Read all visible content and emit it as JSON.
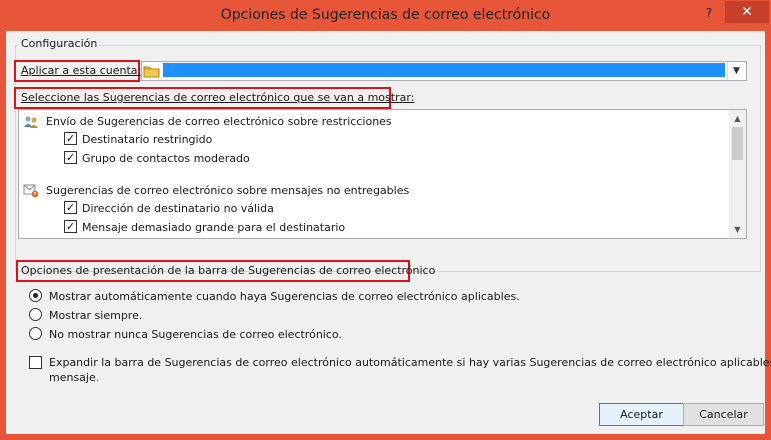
{
  "window": {
    "title": "Opciones de Sugerencias de correo electrónico",
    "help_glyph": "?",
    "close_glyph": "✕"
  },
  "config_group": {
    "label": "Configuración",
    "account_label": "Aplicar a esta cuenta:",
    "account_value": ""
  },
  "tips_list": {
    "label": "Seleccione las Sugerencias de correo electrónico que se van a mostrar:",
    "categories": [
      {
        "icon": "restricted-contacts-icon",
        "label": "Envío de Sugerencias de correo electrónico sobre restricciones",
        "items": [
          {
            "label": "Destinatario restringido",
            "checked": true
          },
          {
            "label": "Grupo de contactos moderado",
            "checked": true
          }
        ]
      },
      {
        "icon": "undeliverable-message-icon",
        "label": "Sugerencias de correo electrónico sobre mensajes no entregables",
        "items": [
          {
            "label": "Dirección de destinatario no válida",
            "checked": true
          },
          {
            "label": "Mensaje demasiado grande para el destinatario",
            "checked": true
          }
        ]
      }
    ]
  },
  "display_options": {
    "label": "Opciones de presentación de la barra de Sugerencias de correo electrónico",
    "radios": [
      {
        "label": "Mostrar automáticamente cuando haya Sugerencias de correo electrónico aplicables.",
        "selected": true
      },
      {
        "label": "Mostrar siempre.",
        "selected": false
      },
      {
        "label": "No mostrar nunca Sugerencias de correo electrónico.",
        "selected": false
      }
    ],
    "expand_checkbox": {
      "line1": "Expandir la barra de Sugerencias de correo electrónico automáticamente si hay varias Sugerencias de correo electrónico aplicables a un",
      "line2": "mensaje.",
      "checked": false
    }
  },
  "buttons": {
    "ok": "Aceptar",
    "cancel": "Cancelar"
  },
  "colors": {
    "titlebar": "#e8563a",
    "highlight": "#d9121c",
    "selection": "#1e90ff"
  }
}
